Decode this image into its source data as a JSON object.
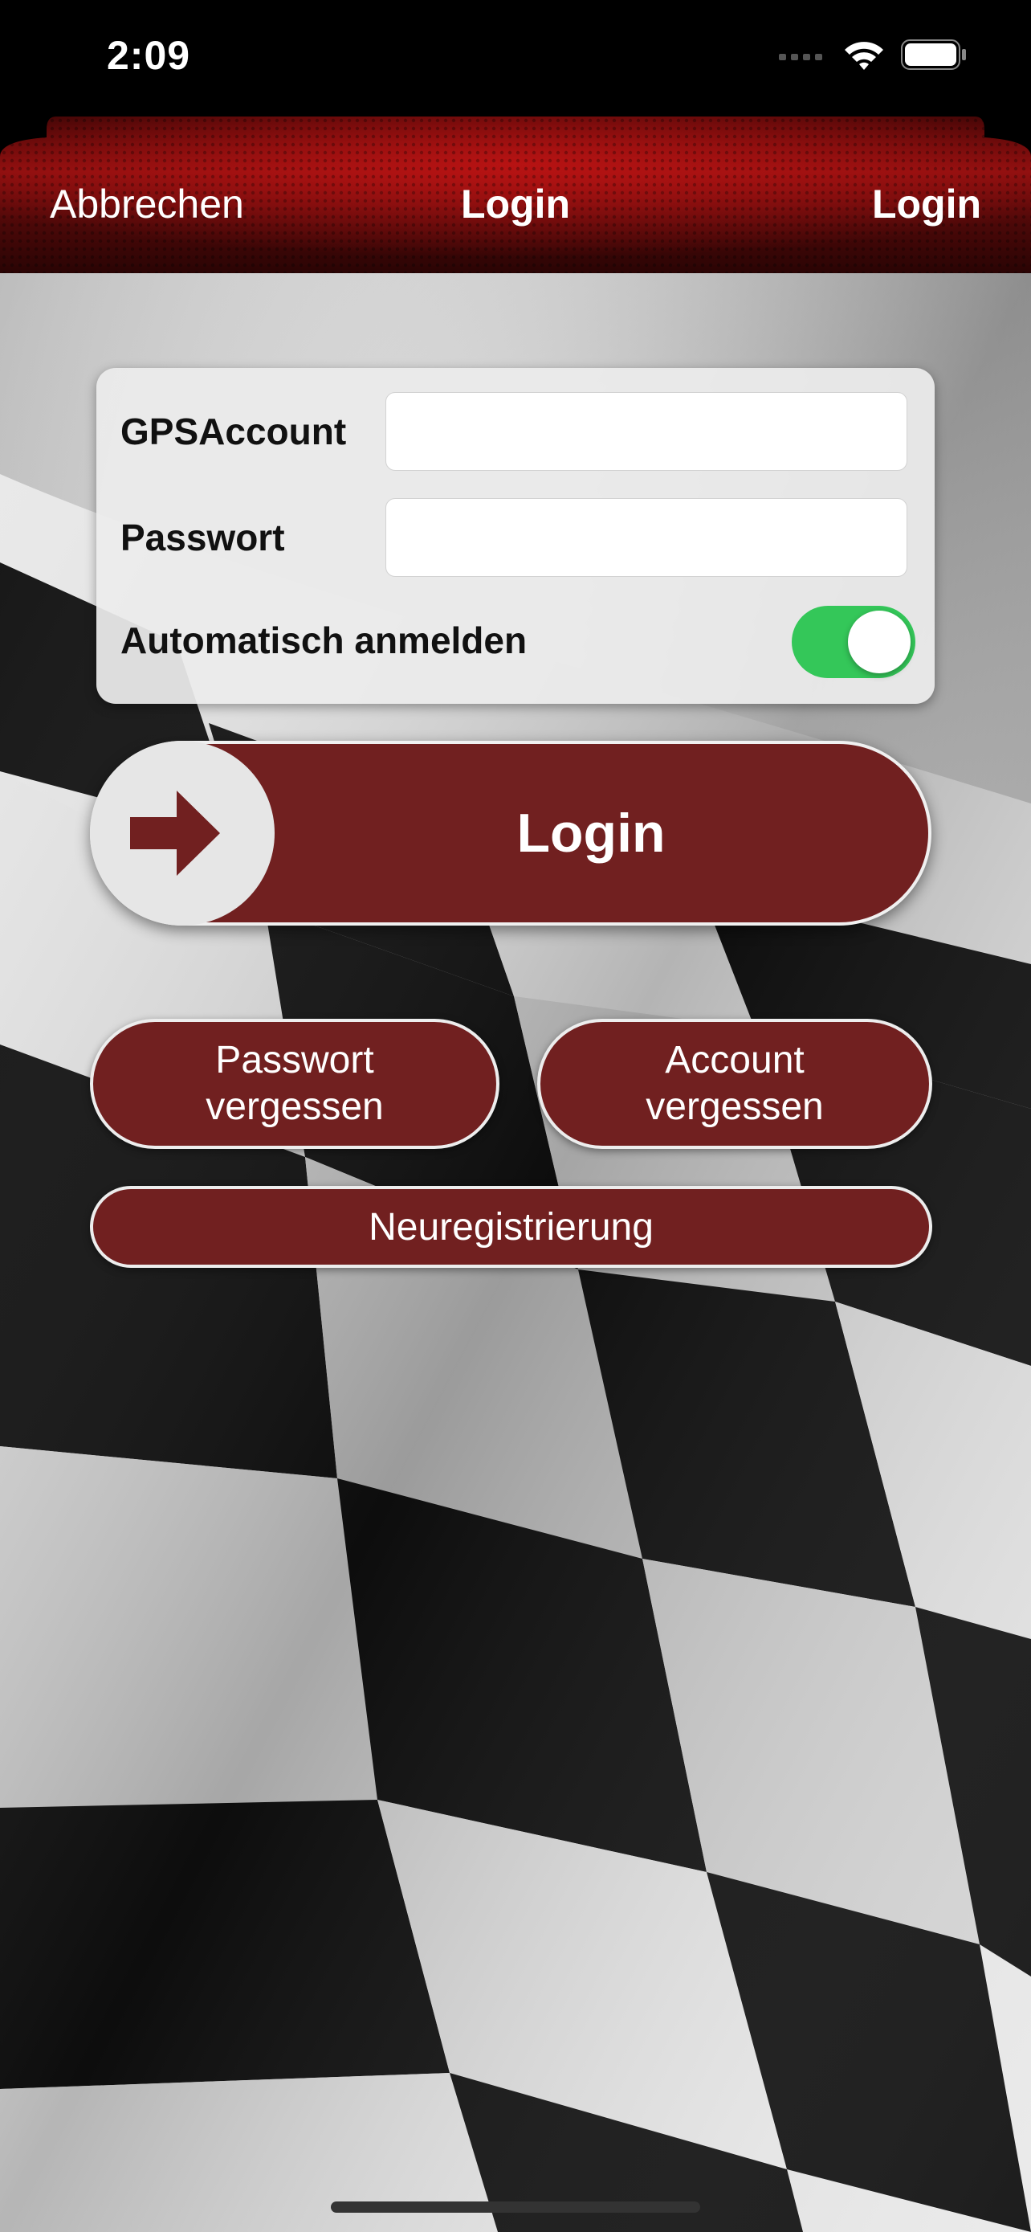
{
  "status_bar": {
    "time": "2:09",
    "icons": [
      "cellular-signal-icon",
      "wifi-icon",
      "battery-icon"
    ]
  },
  "nav_bar": {
    "left_button": "Abbrechen",
    "title": "Login",
    "right_button": "Login"
  },
  "form": {
    "account_label": "GPSAccount",
    "account_value": "",
    "password_label": "Passwort",
    "password_value": "",
    "auto_login_label": "Automatisch anmelden",
    "auto_login_enabled": true
  },
  "buttons": {
    "login_label": "Login",
    "forgot_password_line1": "Passwort",
    "forgot_password_line2": "vergessen",
    "forgot_account_line1": "Account",
    "forgot_account_line2": "vergessen",
    "register_label": "Neuregistrierung"
  },
  "colors": {
    "accent": "#712020",
    "nav_red": "#7a0d0d",
    "toggle_on": "#34c759"
  }
}
